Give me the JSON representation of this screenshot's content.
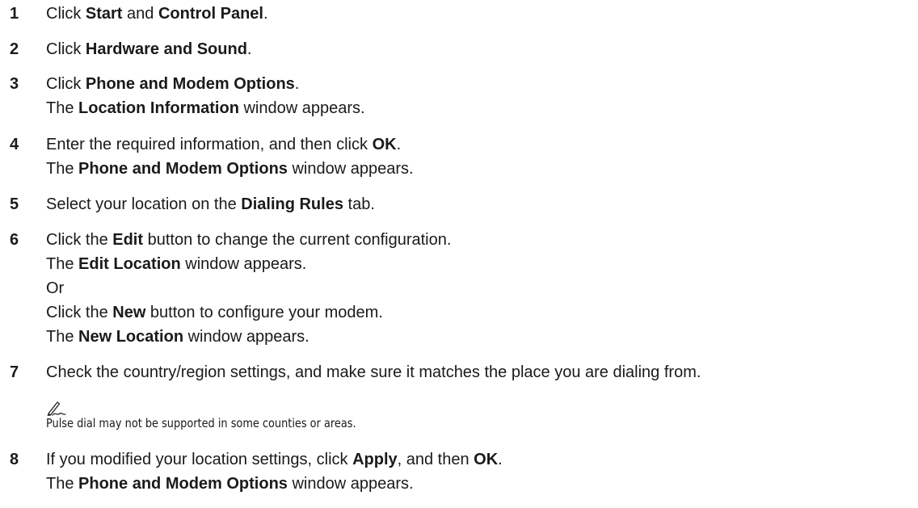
{
  "steps": [
    {
      "number": "1",
      "lines": [
        [
          "Click ",
          {
            "b": "Start"
          },
          " and ",
          {
            "b": "Control Panel"
          },
          "."
        ]
      ]
    },
    {
      "number": "2",
      "lines": [
        [
          "Click ",
          {
            "b": "Hardware and Sound"
          },
          "."
        ]
      ]
    },
    {
      "number": "3",
      "lines": [
        [
          "Click ",
          {
            "b": "Phone and Modem Options"
          },
          "."
        ],
        [
          "The ",
          {
            "b": "Location Information"
          },
          " window appears."
        ]
      ]
    },
    {
      "number": "4",
      "lines": [
        [
          "Enter the required information, and then click ",
          {
            "b": "OK"
          },
          "."
        ],
        [
          "The ",
          {
            "b": "Phone and Modem Options"
          },
          " window appears."
        ]
      ]
    },
    {
      "number": "5",
      "lines": [
        [
          "Select your location on the ",
          {
            "b": "Dialing Rules"
          },
          " tab."
        ]
      ]
    },
    {
      "number": "6",
      "lines": [
        [
          "Click the ",
          {
            "b": "Edit"
          },
          " button to change the current configuration."
        ],
        [
          "The ",
          {
            "b": "Edit Location"
          },
          " window appears."
        ],
        [
          "Or"
        ],
        [
          "Click the ",
          {
            "b": "New"
          },
          " button to configure your modem."
        ],
        [
          "The ",
          {
            "b": "New Location"
          },
          " window appears."
        ]
      ]
    },
    {
      "number": "7",
      "lines": [
        [
          "Check the country/region settings, and make sure it matches the place you are dialing from."
        ]
      ]
    },
    {
      "number": "8",
      "lines": [
        [
          "If you modified your location settings, click ",
          {
            "b": "Apply"
          },
          ", and then ",
          {
            "b": "OK"
          },
          "."
        ],
        [
          "The ",
          {
            "b": "Phone and Modem Options"
          },
          " window appears."
        ]
      ]
    }
  ],
  "note": {
    "icon": "note-pencil-icon",
    "text": "Pulse dial may not be supported in some counties or areas."
  }
}
